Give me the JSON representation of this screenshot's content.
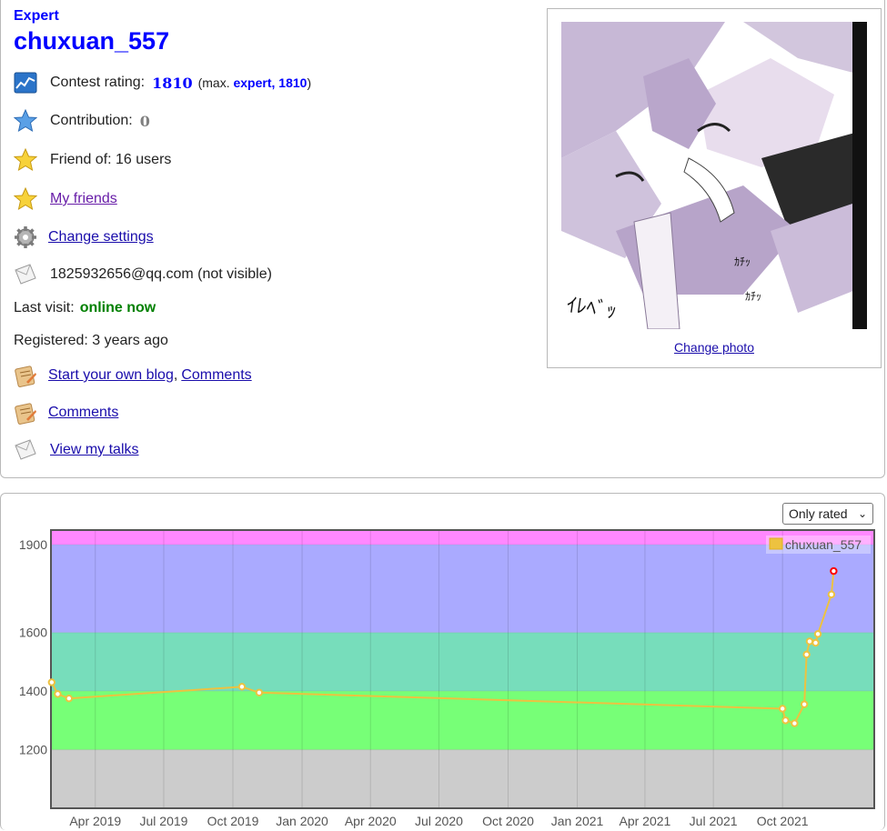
{
  "profile": {
    "rank": "Expert",
    "handle": "chuxuan_557",
    "rating_label": "Contest rating:",
    "rating_value": "1810",
    "max_prefix": "(max.",
    "max_rank_rating": "expert, 1810",
    "max_suffix": ")",
    "contribution_label": "Contribution:",
    "contribution_value": "0",
    "friend_of": "Friend of: 16 users",
    "my_friends": "My friends",
    "change_settings": "Change settings",
    "email": "1825932656@qq.com (not visible)",
    "last_visit_label": "Last visit:",
    "last_visit_value": "online now",
    "registered": "Registered: 3 years ago",
    "blog_link": "Start your own blog",
    "blog_sep": ",",
    "blog_comments": "Comments",
    "comments_link": "Comments",
    "talks_link": "View my talks",
    "change_photo": "Change photo",
    "photo_text_1": "ｲﾚﾍﾞｯ",
    "photo_text_2": "ｶﾁｯ",
    "photo_text_3": "ｶﾁｯ"
  },
  "colors": {
    "rank_blue": "#0000ff",
    "online_green": "#008000",
    "link": "#1a0dab",
    "visited_link": "#681da8",
    "band_purple": "#ff88ff",
    "band_violet": "#aaaaff",
    "band_teal": "#77ddbb",
    "band_green": "#77ff77",
    "band_gray": "#cccccc",
    "line": "#edc240"
  },
  "filter": {
    "selected": "Only rated"
  },
  "chart_data": {
    "type": "line",
    "title": "",
    "xlabel": "",
    "ylabel": "",
    "ylim": [
      1000,
      1950
    ],
    "yticks": [
      "1200",
      "1400",
      "1600",
      "1900"
    ],
    "xticks": [
      "Apr 2019",
      "Jul 2019",
      "Oct 2019",
      "Jan 2020",
      "Apr 2020",
      "Jul 2020",
      "Oct 2020",
      "Jan 2021",
      "Apr 2021",
      "Jul 2021",
      "Oct 2021"
    ],
    "xlim": [
      "2019-02-01",
      "2022-01-31"
    ],
    "legend": "chuxuan_557",
    "legend_position": "top-right",
    "bands": [
      {
        "from": 1900,
        "to": 1950,
        "color": "#ff88ff"
      },
      {
        "from": 1600,
        "to": 1900,
        "color": "#aaaaff"
      },
      {
        "from": 1400,
        "to": 1600,
        "color": "#77ddbb"
      },
      {
        "from": 1200,
        "to": 1400,
        "color": "#77ff77"
      },
      {
        "from": 1000,
        "to": 1200,
        "color": "#cccccc"
      }
    ],
    "series": [
      {
        "name": "chuxuan_557",
        "x": [
          "2019-02-02",
          "2019-02-10",
          "2019-02-25",
          "2019-10-13",
          "2019-11-05",
          "2021-10-01",
          "2021-10-05",
          "2021-10-17",
          "2021-10-30",
          "2021-11-02",
          "2021-11-06",
          "2021-11-14",
          "2021-11-17",
          "2021-12-05",
          "2021-12-08"
        ],
        "y": [
          1430,
          1390,
          1375,
          1415,
          1395,
          1340,
          1300,
          1290,
          1355,
          1525,
          1570,
          1565,
          1595,
          1730,
          1810
        ]
      }
    ]
  }
}
